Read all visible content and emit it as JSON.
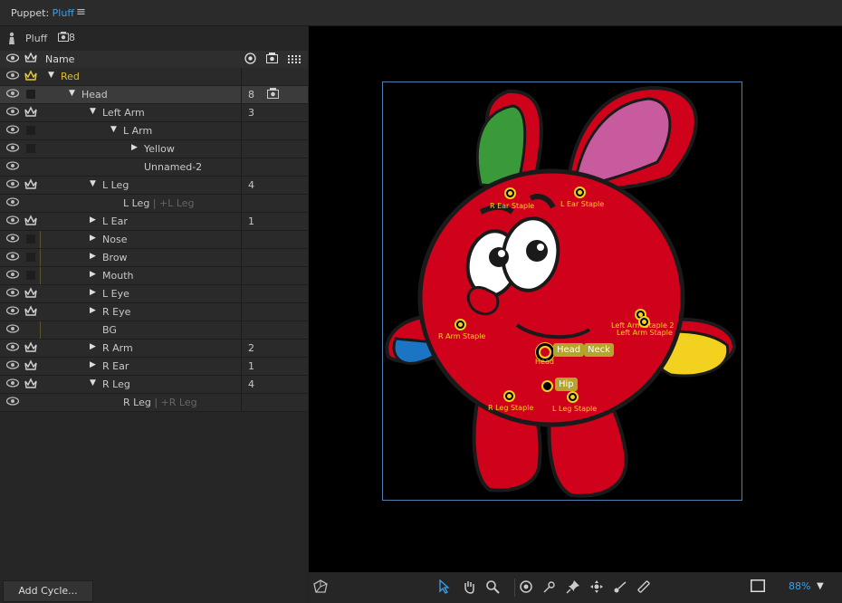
{
  "title": {
    "prefix": "Puppet:",
    "name": "Pluff"
  },
  "menu_glyph": "≡",
  "puppet": {
    "name": "Pluff",
    "count": "8"
  },
  "columns": {
    "name": "Name"
  },
  "rows": [
    {
      "label": "Red",
      "indent": 0,
      "twisty": "down",
      "crown": "gold",
      "gold": true
    },
    {
      "label": "Head",
      "indent": 1,
      "twisty": "down",
      "crown": "square",
      "selected": true,
      "num": "8",
      "cam": true
    },
    {
      "label": "Left Arm",
      "indent": 2,
      "twisty": "down",
      "crown": "white",
      "num": "3"
    },
    {
      "label": "L Arm",
      "indent": 3,
      "twisty": "down",
      "crown": "square"
    },
    {
      "label": "Yellow",
      "indent": 4,
      "twisty": "right",
      "crown": "square"
    },
    {
      "label": "Unnamed-2",
      "indent": 4,
      "twisty": "none",
      "crown": "none"
    },
    {
      "label": "L Leg",
      "indent": 2,
      "twisty": "down",
      "crown": "white",
      "num": "4"
    },
    {
      "label": "L Leg",
      "suffix": " | +L Leg",
      "indent": 3,
      "twisty": "none",
      "crown": "none",
      "eye": false
    },
    {
      "label": "L Ear",
      "indent": 2,
      "twisty": "right",
      "crown": "white",
      "num": "1"
    },
    {
      "label": "Nose",
      "indent": 2,
      "twisty": "right",
      "crown": "square",
      "bar": true
    },
    {
      "label": "Brow",
      "indent": 2,
      "twisty": "right",
      "crown": "square",
      "bar": true
    },
    {
      "label": "Mouth",
      "indent": 2,
      "twisty": "right",
      "crown": "square",
      "bar": true
    },
    {
      "label": "L Eye",
      "indent": 2,
      "twisty": "right",
      "crown": "white"
    },
    {
      "label": "R Eye",
      "indent": 2,
      "twisty": "right",
      "crown": "white"
    },
    {
      "label": "BG",
      "indent": 2,
      "twisty": "none",
      "crown": "none",
      "bar": true
    },
    {
      "label": "R Arm",
      "indent": 2,
      "twisty": "right",
      "crown": "white",
      "num": "2"
    },
    {
      "label": "R Ear",
      "indent": 2,
      "twisty": "right",
      "crown": "white",
      "num": "1"
    },
    {
      "label": "R Leg",
      "indent": 2,
      "twisty": "down",
      "crown": "white",
      "num": "4"
    },
    {
      "label": "R Leg",
      "suffix": " | +R Leg",
      "indent": 3,
      "twisty": "none",
      "crown": "none"
    }
  ],
  "add_cycle": "Add Cycle...",
  "canvas_labels": {
    "r_ear_staple": "R Ear Staple",
    "l_ear_staple": "L Ear Staple",
    "r_arm_staple": "R Arm Staple",
    "left_arm_staple_2": "Left Arm Staple 2",
    "left_arm_staple": "Left Arm Staple",
    "head": "Head",
    "head_tag": "Head",
    "neck_tag": "Neck",
    "hip_tag": "Hip",
    "r_leg_staple": "R Leg Staple",
    "l_leg_staple": "L Leg Staple"
  },
  "zoom": "88%",
  "colors": {
    "accent": "#3da0e8",
    "gold": "#d8bf3c",
    "body": "#d0021b",
    "ear_pink": "#c85a9e",
    "ear_green": "#3a9a3a",
    "hand_yellow": "#f2d21f",
    "hand_blue": "#1b74c4"
  },
  "icons": [
    "eye-icon",
    "crown-icon",
    "camera-icon",
    "select-tool-icon",
    "hand-tool-icon",
    "zoom-tool-icon",
    "origin-tool-icon",
    "dragger-tool-icon",
    "pin-tool-icon",
    "handle-tool-icon",
    "stick-tool-icon",
    "sticky-tool-icon"
  ]
}
